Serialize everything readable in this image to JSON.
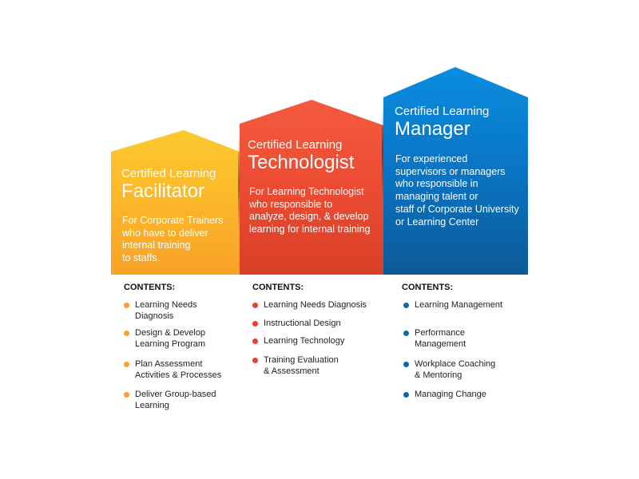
{
  "colors": {
    "facilitator": "#f9a126",
    "technologist": "#e2452c",
    "manager": "#0b6aad"
  },
  "cards": [
    {
      "title_small": "Certified Learning",
      "title_large": "Facilitator",
      "description": [
        "For Corporate Trainers",
        "who have to deliver",
        "internal training",
        "to staffs."
      ],
      "contents_label": "CONTENTS:",
      "contents": [
        [
          "Learning Needs",
          "Diagnosis"
        ],
        [
          "Design & Develop",
          "Learning Program"
        ],
        [
          "Plan Assessment",
          "Activities & Processes"
        ],
        [
          "Deliver Group-based",
          "Learning"
        ]
      ]
    },
    {
      "title_small": "Certified Learning",
      "title_large": "Technologist",
      "description": [
        "For Learning Technologist",
        "who responsible to",
        "analyze, design, & develop",
        "learning for internal training"
      ],
      "contents_label": "CONTENTS:",
      "contents": [
        [
          "Learning Needs Diagnosis"
        ],
        [
          "Instructional Design"
        ],
        [
          "Learning Technology"
        ],
        [
          "Training Evaluation",
          "& Assessment"
        ]
      ]
    },
    {
      "title_small": "Certified Learning",
      "title_large": "Manager",
      "description": [
        "For experienced",
        "supervisors or managers",
        "who responsible in",
        "managing talent or",
        "staff of Corporate University",
        "or Learning Center"
      ],
      "contents_label": "CONTENTS:",
      "contents": [
        [
          "Learning Management"
        ],
        [
          "Performance",
          "Management"
        ],
        [
          "Workplace Coaching",
          "& Mentoring"
        ],
        [
          "Managing Change"
        ]
      ]
    }
  ]
}
